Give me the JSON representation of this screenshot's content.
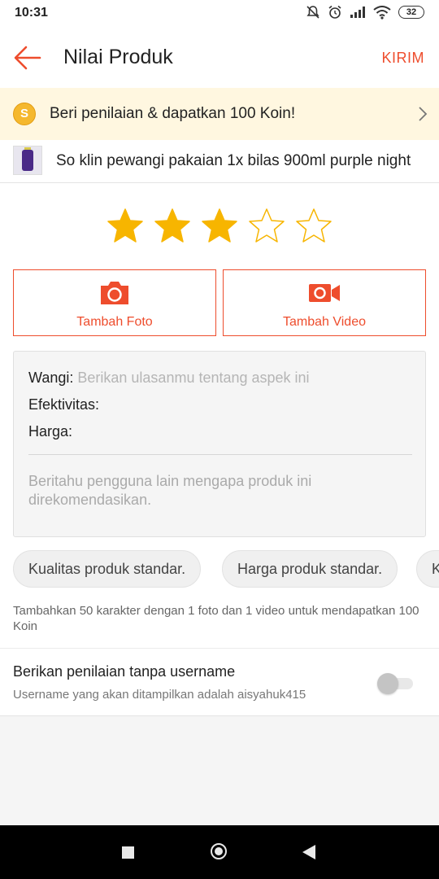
{
  "status": {
    "time": "10:31",
    "battery": "32"
  },
  "appbar": {
    "title": "Nilai Produk",
    "send_label": "KIRIM"
  },
  "coin_banner": {
    "coin_symbol": "S",
    "text": "Beri penilaian & dapatkan 100 Koin!"
  },
  "product": {
    "name": "So klin pewangi pakaian 1x bilas 900ml purple night"
  },
  "rating": {
    "value": 3,
    "max": 5,
    "filled_color": "#f7b500",
    "empty_color": "#f7b500"
  },
  "media": {
    "photo_label": "Tambah Foto",
    "video_label": "Tambah Video"
  },
  "review": {
    "aspects": [
      {
        "label": "Wangi:",
        "placeholder": "Berikan ulasanmu tentang aspek ini"
      },
      {
        "label": "Efektivitas:",
        "placeholder": ""
      },
      {
        "label": "Harga:",
        "placeholder": ""
      }
    ],
    "message_placeholder": "Beritahu pengguna lain mengapa produk ini direkomendasikan."
  },
  "chips": [
    "Kualitas produk standar.",
    "Harga produk standar.",
    "K"
  ],
  "hint": "Tambahkan 50 karakter dengan 1 foto dan 1 video untuk mendapatkan 100 Koin",
  "anonymous": {
    "title": "Berikan penilaian tanpa username",
    "subtitle": "Username yang akan ditampilkan adalah aisyahuk415",
    "enabled": false
  },
  "colors": {
    "accent": "#ee4d2d",
    "banner_bg": "#fff7e0",
    "star": "#f7b500"
  }
}
